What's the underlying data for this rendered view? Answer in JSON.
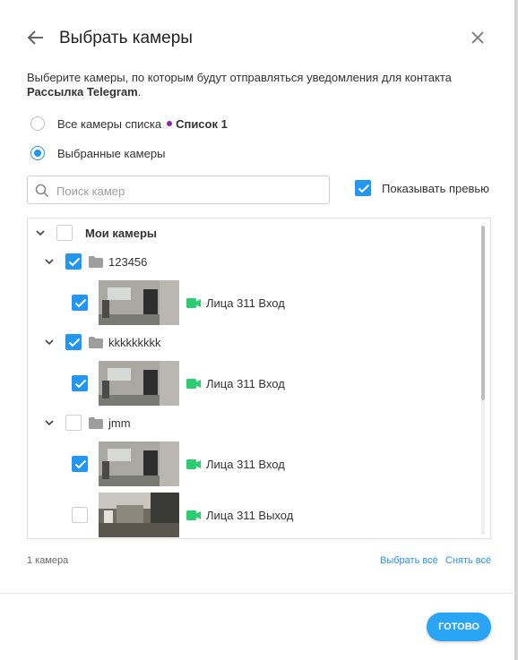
{
  "dialog": {
    "title": "Выбрать камеры",
    "description_prefix": "Выберите камеры, по которым будут отправляться уведомления для контакта",
    "contact_name": "Рассылка Telegram",
    "description_suffix": "."
  },
  "options": {
    "all_cameras_label": "Все камеры списка",
    "list_name": "Список 1",
    "list_color": "#8e24aa",
    "selected_cameras_label": "Выбранные камеры",
    "selected": "selected_cameras"
  },
  "search": {
    "placeholder": "Поиск камер",
    "value": ""
  },
  "preview_toggle": {
    "label": "Показывать превью",
    "checked": true
  },
  "tree": {
    "root_label": "Мои камеры",
    "groups": [
      {
        "name": "123456",
        "checked": true,
        "cameras": [
          {
            "name": "Лица 311 Вход",
            "checked": true
          }
        ]
      },
      {
        "name": "kkkkkkkkk",
        "checked": true,
        "cameras": [
          {
            "name": "Лица 311 Вход",
            "checked": true
          }
        ]
      },
      {
        "name": "jmm",
        "checked": false,
        "cameras": [
          {
            "name": "Лица 311 Вход",
            "checked": true
          },
          {
            "name": "Лица 311 Выход",
            "checked": false
          }
        ]
      }
    ]
  },
  "footer": {
    "count": "1 камера",
    "select_all": "Выбрать всё",
    "deselect_all": "Снять всё",
    "done": "ГОТОВО"
  },
  "colors": {
    "accent": "#2196f3",
    "camera_icon": "#2ecc71",
    "done_button": "#2aa5f5"
  }
}
